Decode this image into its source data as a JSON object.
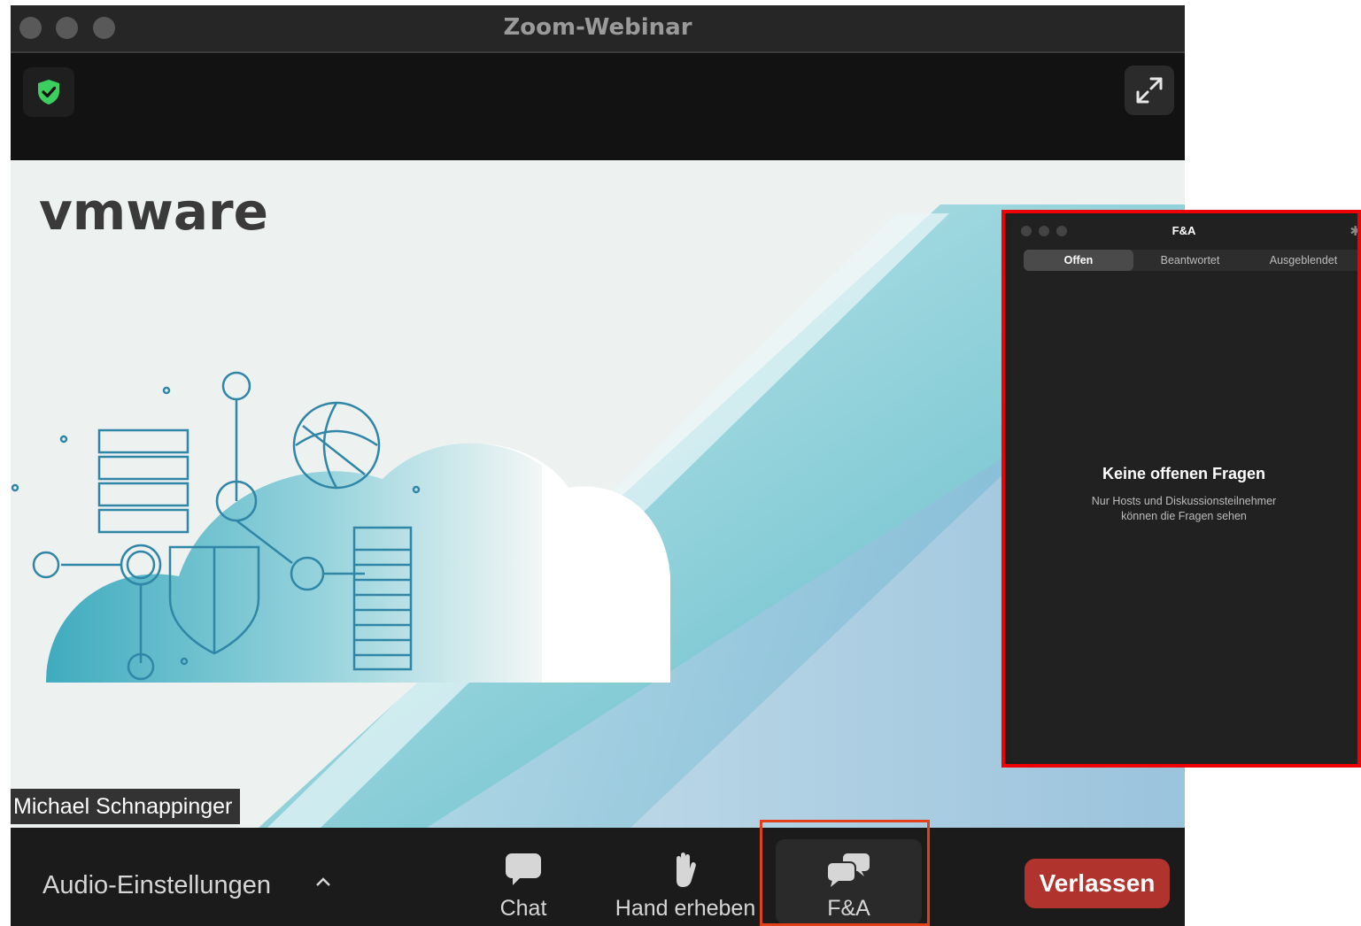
{
  "window": {
    "title": "Zoom-Webinar"
  },
  "stage": {
    "brand": "vmware",
    "presenter_name": "Michael Schnappinger"
  },
  "toolbar": {
    "audio_label": "Audio-Einstellungen",
    "chat_label": "Chat",
    "raise_hand_label": "Hand erheben",
    "qa_label": "F&A",
    "leave_label": "Verlassen"
  },
  "qa_panel": {
    "title": "F&A",
    "tabs": [
      {
        "label": "Offen",
        "active": true
      },
      {
        "label": "Beantwortet",
        "active": false
      },
      {
        "label": "Ausgeblendet",
        "active": false
      }
    ],
    "empty_title": "Keine offenen Fragen",
    "empty_subtitle": "Nur Hosts und Diskussionsteilnehmer können die Fragen sehen"
  },
  "icons": {
    "security": "shield-check-icon",
    "fullscreen": "expand-arrows-icon",
    "chat": "chat-bubble-icon",
    "raise_hand": "hand-icon",
    "qa": "qa-bubbles-icon",
    "settings": "gear-icon"
  },
  "colors": {
    "leave_button": "#b1332e",
    "security_green": "#3ccf5e",
    "highlight_red": "#f00000",
    "slide_teal": "#3bb0c1"
  }
}
